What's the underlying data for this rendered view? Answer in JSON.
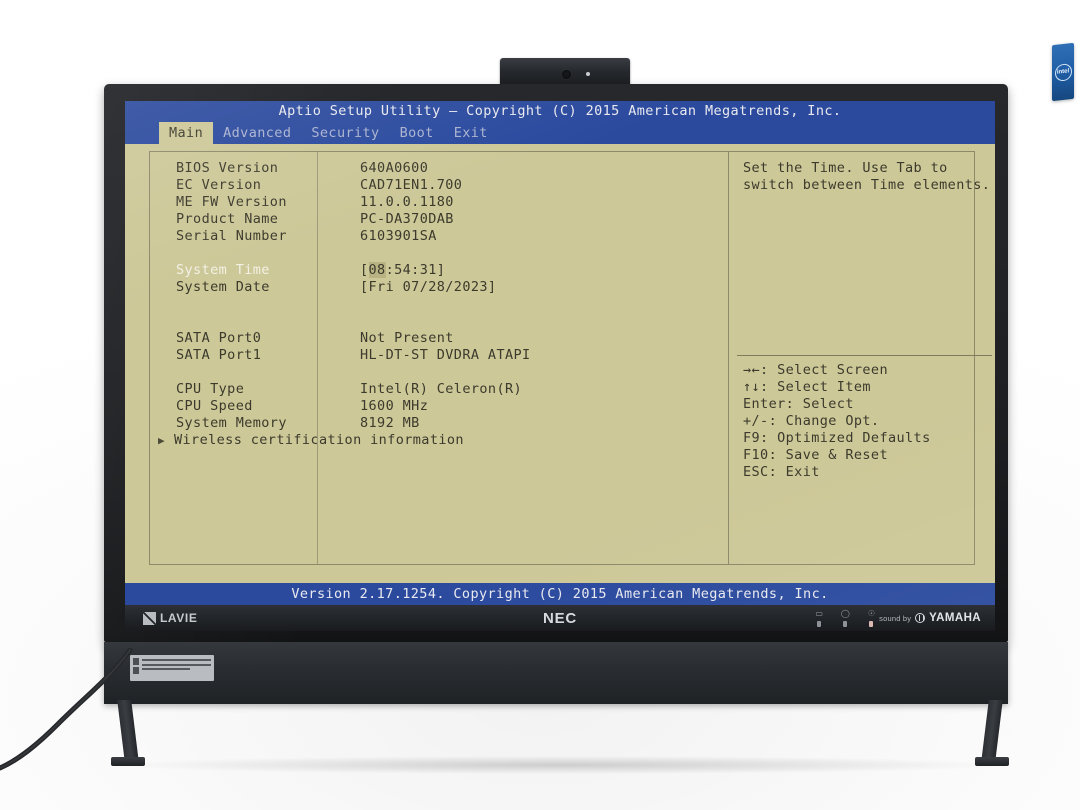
{
  "device": {
    "brand_left": "LAVIE",
    "brand_center": "NEC",
    "audio_brand_prefix": "sound by",
    "audio_brand": "YAMAHA",
    "cpu_badge": "intel",
    "indicators": [
      "power-indicator",
      "drive-indicator",
      "status-indicator"
    ]
  },
  "bios": {
    "title": "Aptio Setup Utility – Copyright (C) 2015 American Megatrends, Inc.",
    "footer": "Version 2.17.1254. Copyright (C) 2015 American Megatrends, Inc.",
    "menu": [
      {
        "label": "Main",
        "active": true
      },
      {
        "label": "Advanced",
        "active": false
      },
      {
        "label": "Security",
        "active": false
      },
      {
        "label": "Boot",
        "active": false
      },
      {
        "label": "Exit",
        "active": false
      }
    ],
    "rows": [
      {
        "label": "BIOS Version",
        "value": "640A0600",
        "highlight": false
      },
      {
        "label": "EC Version",
        "value": "CAD71EN1.700",
        "highlight": false
      },
      {
        "label": "ME FW Version",
        "value": "11.0.0.1180",
        "highlight": false
      },
      {
        "label": "Product Name",
        "value": "PC-DA370DAB",
        "highlight": false
      },
      {
        "label": "Serial Number",
        "value": "6103901SA",
        "highlight": false
      },
      {
        "label": "",
        "value": "",
        "highlight": false
      },
      {
        "label": "System Time",
        "value": "[08:54:31]",
        "highlight": true,
        "cursor": "08"
      },
      {
        "label": "System Date",
        "value": "[Fri 07/28/2023]",
        "highlight": false
      },
      {
        "label": "",
        "value": "",
        "highlight": false
      },
      {
        "label": "",
        "value": "",
        "highlight": false
      },
      {
        "label": "SATA Port0",
        "value": "Not Present",
        "highlight": false
      },
      {
        "label": "SATA Port1",
        "value": "HL-DT-ST DVDRA ATAPI",
        "highlight": false
      },
      {
        "label": "",
        "value": "",
        "highlight": false
      },
      {
        "label": "CPU Type",
        "value": "Intel(R) Celeron(R)",
        "highlight": false
      },
      {
        "label": "CPU Speed",
        "value": "1600 MHz",
        "highlight": false
      },
      {
        "label": "System Memory",
        "value": "8192 MB",
        "highlight": false
      }
    ],
    "submenu": {
      "arrow": "▶",
      "label": "Wireless certification information"
    },
    "help": {
      "line1": "Set the Time. Use Tab to",
      "line2": "switch between Time elements."
    },
    "keys": [
      "→←: Select Screen",
      "↑↓: Select Item",
      "Enter: Select",
      "+/-: Change Opt.",
      "F9: Optimized Defaults",
      "F10: Save & Reset",
      "ESC: Exit"
    ],
    "colors": {
      "background": "#cdc898",
      "bar": "#2b4a9e",
      "bar_text": "#e9e9ef",
      "text": "#3b3a2c",
      "text_highlight": "#f2f1e4",
      "border": "#8d8a6a"
    }
  }
}
